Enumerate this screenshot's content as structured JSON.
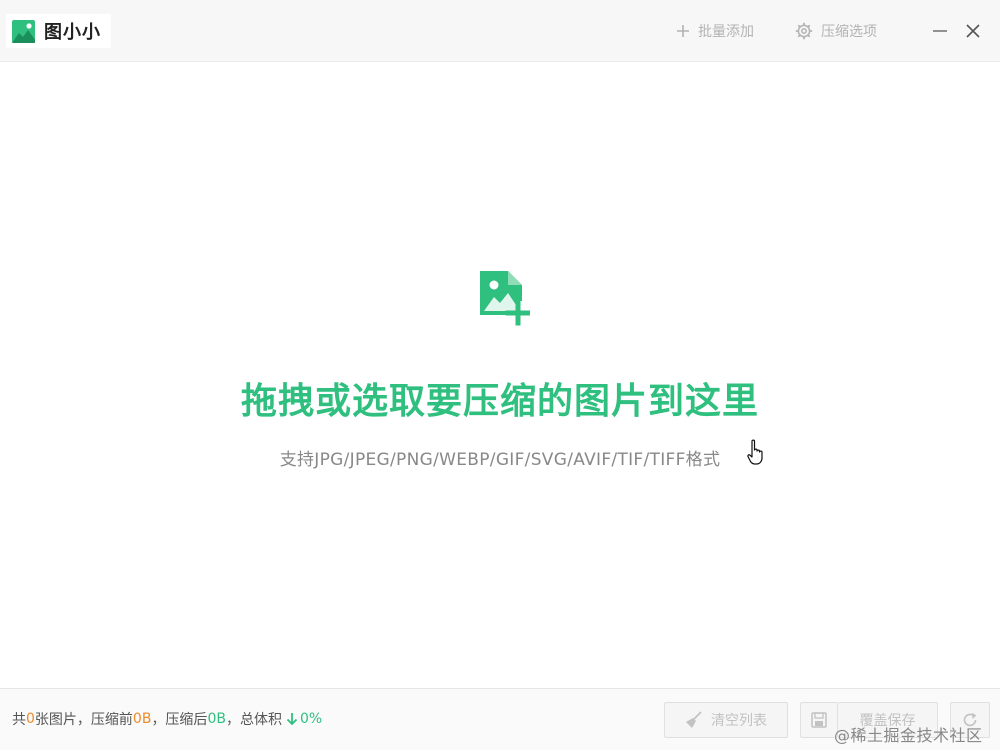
{
  "titlebar": {
    "app_title": "图小小",
    "batch_add_label": "批量添加",
    "compress_options_label": "压缩选项"
  },
  "dropzone": {
    "title": "拖拽或选取要压缩的图片到这里",
    "subtitle": "支持JPG/JPEG/PNG/WEBP/GIF/SVG/AVIF/TIF/TIFF格式"
  },
  "footer": {
    "stats": {
      "prefix": "共",
      "count": "0",
      "count_suffix": "张图片，压缩前",
      "before_size": "0B",
      "after_label": "，压缩后",
      "after_size": "0B",
      "total_label": "，总体积",
      "ratio": "0%"
    },
    "clear_list_label": "清空列表",
    "resave_label": "覆盖保存"
  },
  "watermark": "@稀土掘金技术社区",
  "colors": {
    "accent": "#2fbf7f",
    "before_size": "#f08a24",
    "disabled": "#c2c2c2"
  },
  "icons": {
    "logo": "image-logo-icon",
    "batch_add": "plus-icon",
    "options": "gear-icon",
    "minimize": "minimize-icon",
    "close": "close-icon",
    "dropzone": "image-add-icon",
    "clear": "broom-icon",
    "save": "save-icon",
    "refresh": "refresh-icon",
    "ratio": "arrow-down-icon"
  }
}
